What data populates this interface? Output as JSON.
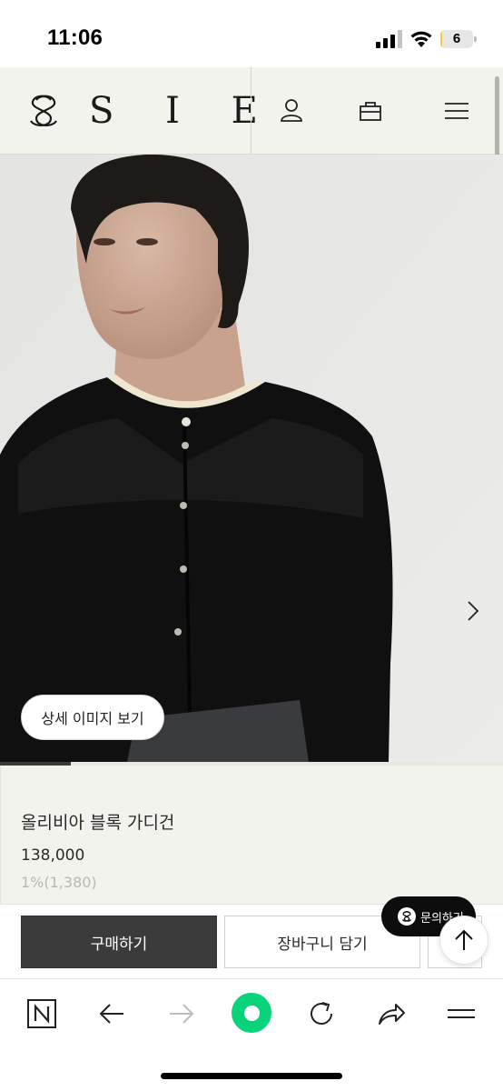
{
  "status_bar": {
    "time": "11:06",
    "battery_level": "6",
    "battery_fraction": 0.06,
    "icons": [
      "signal-icon",
      "wifi-icon",
      "battery-icon"
    ]
  },
  "header": {
    "logo_text": "S I E",
    "icons": [
      "sie-logo-mark",
      "user-icon",
      "shopping-bag-icon",
      "hamburger-menu-icon"
    ]
  },
  "gallery": {
    "detail_button_label": "상세 이미지 보기",
    "slider_progress": 0.14,
    "next_icon": "chevron-right-icon"
  },
  "product": {
    "name": "올리비아 블록 가디건",
    "price": "138,000",
    "points": "1%(1,380)"
  },
  "actions": {
    "buy_label": "구매하기",
    "cart_label": "장바구니 담기",
    "inquiry_label": "문의하기",
    "top_icon": "arrow-up-icon"
  },
  "browser_toolbar": {
    "icons": [
      "naver-n-icon",
      "back-arrow-icon",
      "forward-arrow-icon",
      "green-home-button",
      "refresh-icon",
      "share-icon",
      "menu-lines-icon"
    ]
  },
  "colors": {
    "header_bg": "#f3f3ee",
    "buy_button_bg": "#3b3b3b",
    "green_button": "#06d37a",
    "battery_fill": "#f2cc3d"
  }
}
